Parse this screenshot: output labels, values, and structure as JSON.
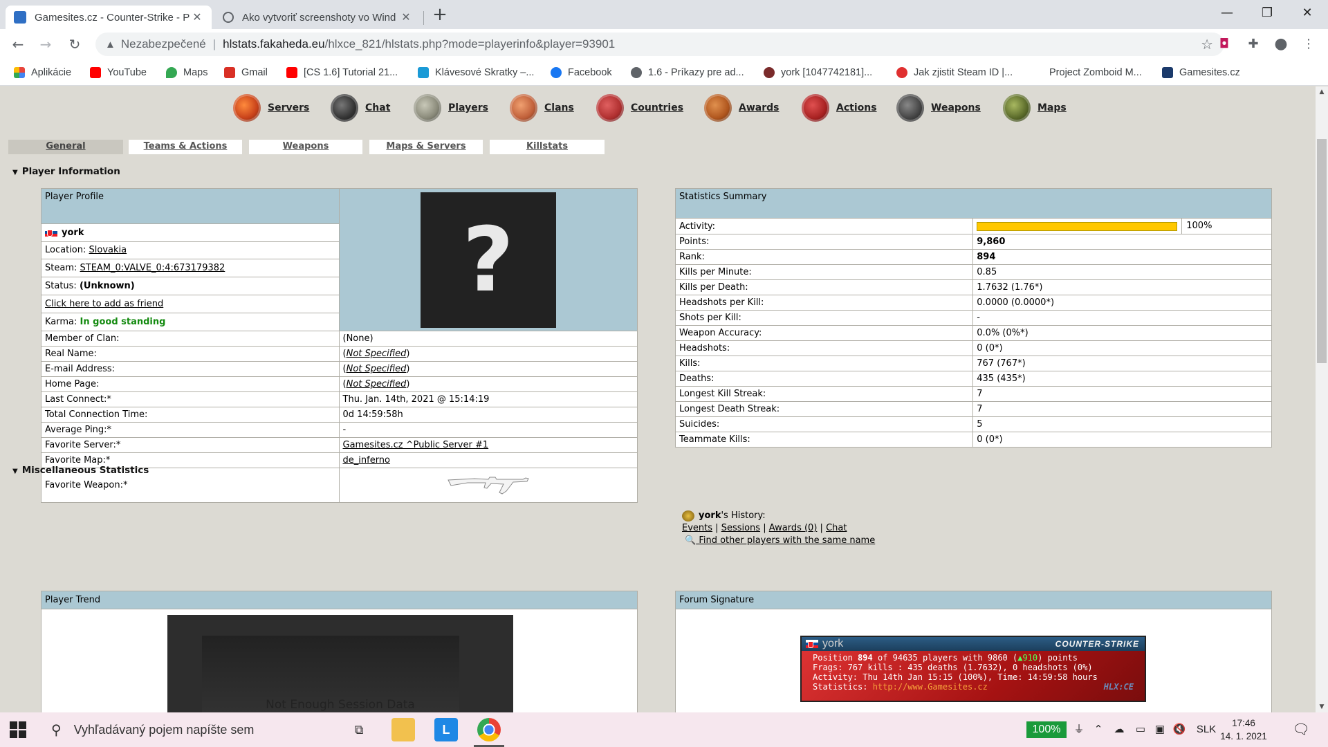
{
  "browser": {
    "tabs": [
      {
        "title": "Gamesites.cz - Counter-Strike - P",
        "fav_color": "#2f6fc4"
      },
      {
        "title": "Ako vytvoriť screenshoty vo Wind",
        "fav_color": "#5f6368"
      }
    ],
    "newtab": "+",
    "window_controls": {
      "minimize": "—",
      "maximize": "❐",
      "close": "✕"
    },
    "address": {
      "security": "Nezabezpečené",
      "host": "hlstats.fakaheda.eu",
      "path": "/hlxce_821/hlstats.php?mode=playerinfo&player=93901"
    },
    "bookmarks": [
      {
        "label": "Aplikácie",
        "color": "#e8453c"
      },
      {
        "label": "YouTube",
        "color": "#ff0000"
      },
      {
        "label": "Maps",
        "color": "#34a853"
      },
      {
        "label": "Gmail",
        "color": "#d93025"
      },
      {
        "label": "[CS 1.6] Tutorial 21...",
        "color": "#ff0000"
      },
      {
        "label": "Klávesové Skratky –...",
        "color": "#1a9ad6"
      },
      {
        "label": "Facebook",
        "color": "#1877f2"
      },
      {
        "label": "1.6 - Príkazy pre ad...",
        "color": "#5f6368"
      },
      {
        "label": "york [1047742181]...",
        "color": "#7a2b2b"
      },
      {
        "label": "Jak zjistit Steam ID |...",
        "color": "#e03030"
      },
      {
        "label": "Project Zomboid M...",
        "color": "#ffffff"
      },
      {
        "label": "Gamesites.cz",
        "color": "#1b3a6b"
      }
    ]
  },
  "nav": [
    {
      "label": "Servers",
      "color": "#c8421a"
    },
    {
      "label": "Chat",
      "color": "#333333"
    },
    {
      "label": "Players",
      "color": "#8a8a7a"
    },
    {
      "label": "Clans",
      "color": "#c0603a"
    },
    {
      "label": "Countries",
      "color": "#b03030"
    },
    {
      "label": "Awards",
      "color": "#b0561e"
    },
    {
      "label": "Actions",
      "color": "#a82222"
    },
    {
      "label": "Weapons",
      "color": "#444444"
    },
    {
      "label": "Maps",
      "color": "#5a6a2a"
    }
  ],
  "subtabs": [
    "General",
    "Teams & Actions",
    "Weapons",
    "Maps & Servers",
    "Killstats"
  ],
  "sections": {
    "player_info": "Player Information",
    "misc": "Miscellaneous Statistics"
  },
  "profile": {
    "header": "Player Profile",
    "name": "york",
    "location_label": "Location:",
    "location": "Slovakia",
    "steam_label": "Steam:",
    "steam": "STEAM_0:VALVE_0:4:673179382",
    "status_label": "Status:",
    "status": "(Unknown)",
    "friend_link": "Click here to add as friend",
    "karma_label": "Karma:",
    "karma": "In good standing",
    "avatar_glyph": "?",
    "rows": [
      {
        "label": "Member of Clan:",
        "value": "(None)"
      },
      {
        "label": "Real Name:",
        "value": "Not Specified"
      },
      {
        "label": "E-mail Address:",
        "value": "Not Specified"
      },
      {
        "label": "Home Page:",
        "value": "Not Specified"
      },
      {
        "label": "Last Connect:*",
        "value": "Thu. Jan. 14th, 2021 @ 15:14:19"
      },
      {
        "label": "Total Connection Time:",
        "value": "0d 14:59:58h"
      },
      {
        "label": "Average Ping:*",
        "value": "-"
      },
      {
        "label": "Favorite Server:*",
        "value": "Gamesites.cz ^Public Server #1"
      },
      {
        "label": "Favorite Map:*",
        "value": "de_inferno"
      },
      {
        "label": "Favorite Weapon:*",
        "value": ""
      }
    ]
  },
  "stats": {
    "header": "Statistics Summary",
    "activity_label": "Activity:",
    "activity_pct_text": "100%",
    "activity_fraction": 1.0,
    "rows": [
      {
        "label": "Points:",
        "value": "9,860"
      },
      {
        "label": "Rank:",
        "value": "894"
      },
      {
        "label": "Kills per Minute:",
        "value": "0.85"
      },
      {
        "label": "Kills per Death:",
        "value": "1.7632 (1.76*)"
      },
      {
        "label": "Headshots per Kill:",
        "value": "0.0000 (0.0000*)"
      },
      {
        "label": "Shots per Kill:",
        "value": "-"
      },
      {
        "label": "Weapon Accuracy:",
        "value": "0.0% (0%*)"
      },
      {
        "label": "Headshots:",
        "value": "0 (0*)"
      },
      {
        "label": "Kills:",
        "value": "767 (767*)"
      },
      {
        "label": "Deaths:",
        "value": "435 (435*)"
      },
      {
        "label": "Longest Kill Streak:",
        "value": "7"
      },
      {
        "label": "Longest Death Streak:",
        "value": "7"
      },
      {
        "label": "Suicides:",
        "value": "5"
      },
      {
        "label": "Teammate Kills:",
        "value": "0 (0*)"
      }
    ]
  },
  "history": {
    "name": "york",
    "suffix": "'s History:",
    "links": [
      "Events",
      "Sessions",
      "Awards (0)",
      "Chat"
    ],
    "separator": "|",
    "find": " Find other players with the same name"
  },
  "misc": {
    "trend_header": "Player Trend",
    "trend_msg": "Not Enough Session Data",
    "signature_header": "Forum Signature",
    "sig": {
      "name": "york",
      "logo": "COUNTER-STRIKE",
      "line1_a": "Position ",
      "line1_pos": "894",
      "line1_b": " of 94635 players with 9860 (",
      "line1_delta": "▲910",
      "line1_c": ") points",
      "line2": "Frags: 767 kills : 435 deaths (1.7632), 0 headshots (0%)",
      "line3": "Activity: Thu 14th Jan 15:15 (100%), Time: 14:59:58 hours",
      "line4_a": "Statistics: ",
      "line4_link": "http://www.Gamesites.cz",
      "watermark": "HLX:CE"
    }
  },
  "taskbar": {
    "search_placeholder": "Vyhľadávaný pojem napíšte sem",
    "battery": "100%",
    "lang": "SLK",
    "time": "17:46",
    "date": "14. 1. 2021"
  }
}
